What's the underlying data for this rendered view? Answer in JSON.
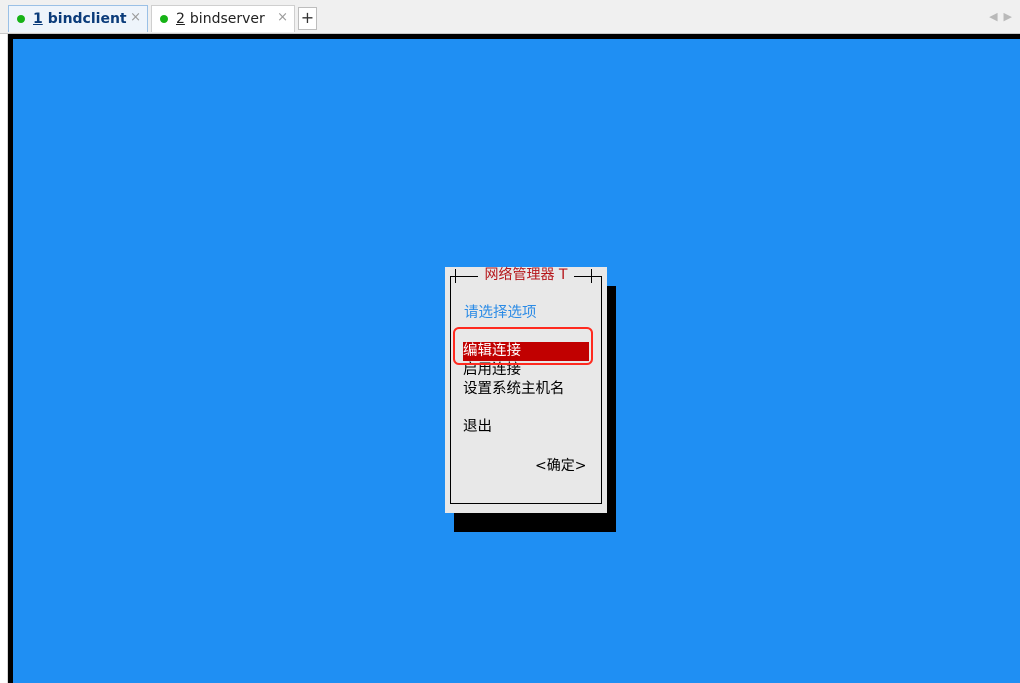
{
  "tabs": [
    {
      "number": "1",
      "label": "bindclient",
      "close": "×",
      "active": true
    },
    {
      "number": "2",
      "label": "bindserver",
      "close": "×",
      "active": false
    }
  ],
  "new_tab_label": "+",
  "dialog": {
    "title": "网络管理器 T",
    "prompt": "请选择选项",
    "menu_items": [
      "编辑连接",
      "启用连接",
      "设置系统主机名",
      "退出"
    ],
    "selected_index": 0,
    "ok_label": "<确定>"
  },
  "colors": {
    "terminal_background": "#1f8ff3",
    "dialog_background": "#e8e8e8",
    "selection_background": "#c10000",
    "title_color": "#b5161a",
    "prompt_color": "#2b8be6",
    "annotation_border": "#ff2a1f",
    "status_dot": "#17b317"
  }
}
